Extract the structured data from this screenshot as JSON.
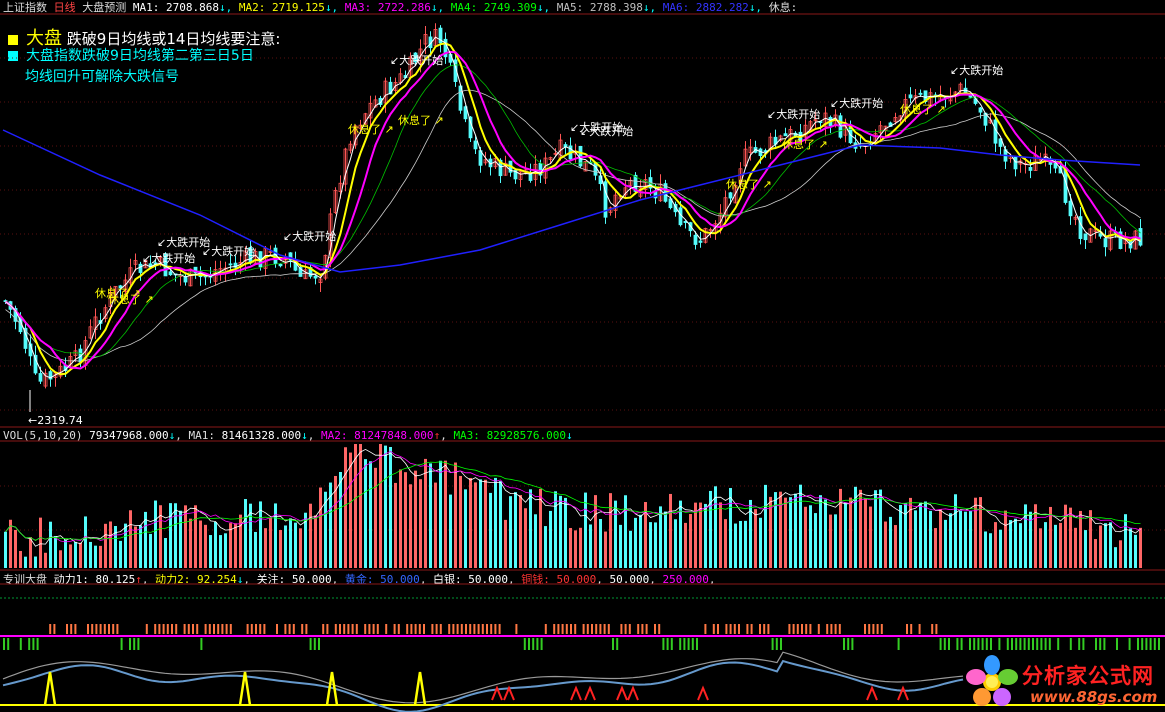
{
  "header": {
    "index_name": "上证指数",
    "period": "日线",
    "formula": "大盘预测",
    "ma_items": [
      {
        "label": "MA1:",
        "value": "2708.868",
        "arrow": "↓",
        "color": "#ffffff"
      },
      {
        "label": "MA2:",
        "value": "2719.125",
        "arrow": "↓",
        "color": "#ffff00"
      },
      {
        "label": "MA3:",
        "value": "2722.286",
        "arrow": "↓",
        "color": "#ff00ff"
      },
      {
        "label": "MA4:",
        "value": "2749.309",
        "arrow": "↓",
        "color": "#00ff00"
      },
      {
        "label": "MA5:",
        "value": "2788.398",
        "arrow": "↓",
        "color": "#c0c0c0"
      },
      {
        "label": "MA6:",
        "value": "2882.282",
        "arrow": "↓",
        "color": "#3333ff"
      }
    ],
    "rest_label": "休息:"
  },
  "legend": {
    "line1_big": "大盘",
    "line1_text": "跌破9日均线或14日均线要注意:",
    "line2_text": "大盘指数跌破9日均线第二第三日5日",
    "line3_text": "均线回升可解除大跌信号",
    "yellow": "#ffff00",
    "cyan": "#00ffff"
  },
  "price_annotations": {
    "low_label": "←2319.74",
    "drop_start": "大跌开始",
    "rest": "休息了"
  },
  "volume_header": {
    "name": "VOL(5,10,20)",
    "value": "79347968.000",
    "arrow": "↓",
    "ma1": "81461328.000",
    "ma2": "81247848.000",
    "ma3": "82928576.000",
    "ma1_label": "MA1:",
    "ma2_label": "MA2:",
    "ma3_label": "MA3:",
    "ma2_arrow": "↑",
    "ma3_arrow": "↓",
    "ma1_arrow": "↓"
  },
  "indicator_header": {
    "name": "专训大盘",
    "items": [
      {
        "label": "动力1:",
        "value": "80.125",
        "arrow": "↑",
        "color": "#ffffff"
      },
      {
        "label": "动力2:",
        "value": "92.254",
        "arrow": "↓",
        "color": "#ffff00"
      },
      {
        "label": "关注:",
        "value": "50.000",
        "arrow": "",
        "color": "#ffffff"
      },
      {
        "label": "黄金:",
        "value": "50.000",
        "arrow": "",
        "color": "#3366ff"
      },
      {
        "label": "白银:",
        "value": "50.000",
        "arrow": "",
        "color": "#ffffff"
      },
      {
        "label": "铜钱:",
        "value": "50.000",
        "arrow": "",
        "color": "#ff3333"
      },
      {
        "label": "",
        "value": "50.000",
        "arrow": "",
        "color": "#ffffff"
      },
      {
        "label": "",
        "value": "250.000",
        "arrow": "",
        "color": "#ff00ff"
      }
    ]
  },
  "watermark": {
    "title": "分析家公式网",
    "url": "www.88gs.com"
  },
  "colors": {
    "up": "#ff5555",
    "down": "#54fcfc",
    "grid": "#8a1818",
    "ma_white": "#ffffff",
    "ma_yellow": "#ffff00",
    "ma_magenta": "#ff00ff",
    "ma_green": "#00c000",
    "ma_blue": "#2020ff"
  }
}
